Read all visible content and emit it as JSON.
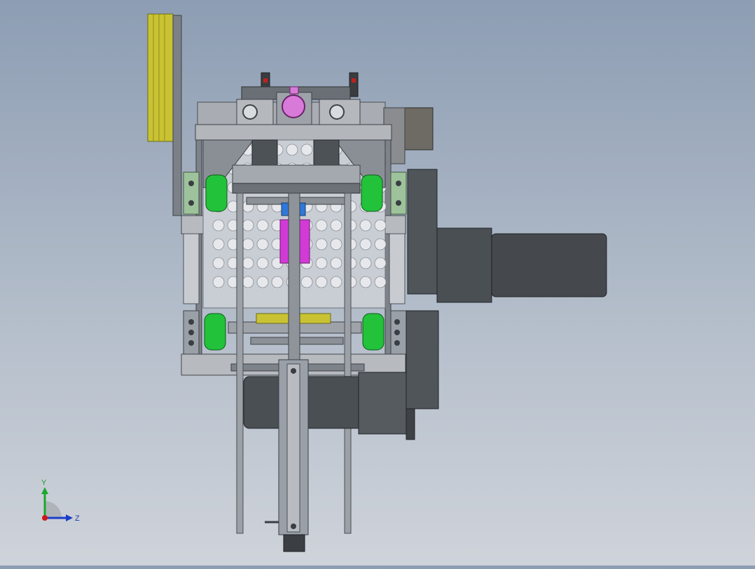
{
  "triad": {
    "y_label": "Y",
    "z_label": "Z",
    "colors": {
      "x": "#d01818",
      "y": "#1aa82b",
      "z": "#1b3ec8"
    }
  },
  "model": {
    "colors": {
      "background_top": "#8d9db3",
      "background_bottom": "#cfd3da",
      "frame": "#9aa0a8",
      "frame_dark": "#5f656c",
      "motor": "#4a4f54",
      "wheel": "#22c23a",
      "yellow_panel": "#c9c333",
      "magenta_part": "#d23ad6",
      "blue_part": "#2f78d8",
      "pink_part": "#d87ad8",
      "perforated_plate": "#c9cdd4"
    }
  }
}
